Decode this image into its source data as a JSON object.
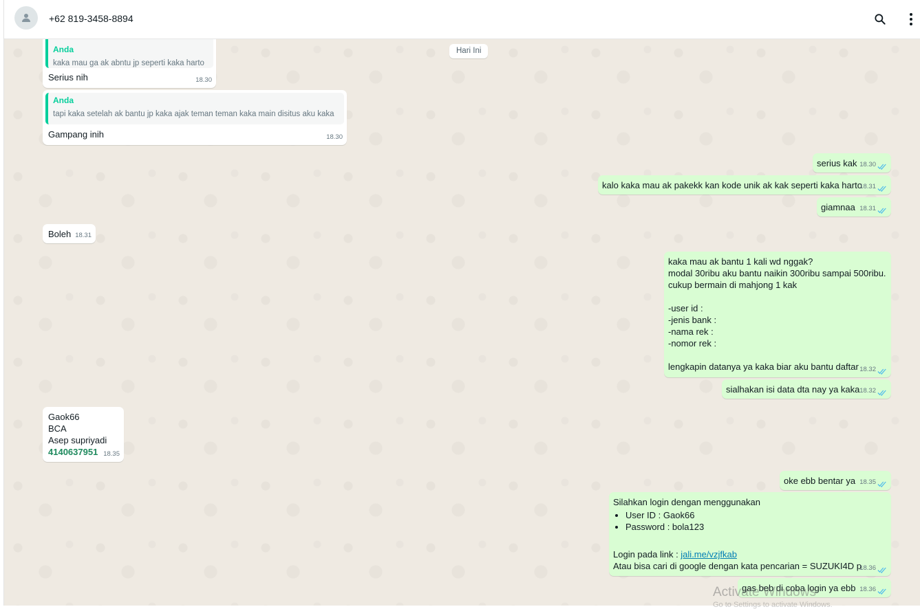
{
  "header": {
    "contact_name": "+62 819-3458-8894",
    "icons": [
      "person-icon",
      "search-icon",
      "menu-dots-icon"
    ]
  },
  "chat": {
    "date_chip": "Hari Ini",
    "messages": [
      {
        "dir": "in",
        "quote_name": "Anda",
        "quote_text": "kaka mau ga ak abntu jp seperti kaka harto",
        "text": "Serius nih",
        "time": "18.30"
      },
      {
        "dir": "in",
        "quote_name": "Anda",
        "quote_text": "tapi kaka setelah ak bantu jp kaka ajak teman teman kaka main disitus aku kaka",
        "text": "Gampang inih",
        "time": "18.30"
      },
      {
        "dir": "out",
        "text": "serius kak",
        "time": "18.30"
      },
      {
        "dir": "out",
        "text": "kalo kaka mau ak pakekk kan kode unik ak kak seperti kaka harto",
        "time": "18.31"
      },
      {
        "dir": "out",
        "text": "giamnaa",
        "time": "18.31"
      },
      {
        "dir": "in",
        "text": "Boleh",
        "time": "18.31"
      },
      {
        "dir": "out",
        "text": "kaka mau ak bantu 1 kali wd nggak?\nmodal 30ribu aku bantu naikin 300ribu sampai 500ribu.\ncukup bermain di mahjong 1 kak\n\n-user id :\n-jenis bank :\n-nama rek :\n-nomor rek :\n\nlengkapin datanya ya kaka biar aku bantu daftar",
        "time": "18.32"
      },
      {
        "dir": "out",
        "text": "sialhakan isi data dta nay ya kaka",
        "time": "18.32"
      },
      {
        "dir": "in",
        "text": "Gaok66\nBCA\nAsep supriyadi",
        "account": "4140637951",
        "time": "18.35"
      },
      {
        "dir": "out",
        "text": "oke ebb bentar ya",
        "time": "18.35"
      },
      {
        "dir": "out",
        "intro": "Silahkan login dengan menggunakan",
        "bullets": [
          "User ID : Gaok66",
          "Password : bola123"
        ],
        "link_prefix": "Login pada link : ",
        "link": "jali.me/vzjfkab",
        "after": "Atau bisa cari di google dengan kata pencarian = SUZUKI4D p",
        "time": "18.36"
      },
      {
        "dir": "out",
        "text": "gas beb di coba login ya ebb",
        "time": "18.36"
      }
    ]
  },
  "watermark": {
    "line1": "Activate Windows",
    "line2": "Go to Settings to activate Windows."
  },
  "colors": {
    "outgoing": "#d9fdd3",
    "incoming": "#ffffff",
    "chat_bg": "#efeae2",
    "quote_accent": "#06cf9c",
    "tick": "#53bdeb"
  }
}
